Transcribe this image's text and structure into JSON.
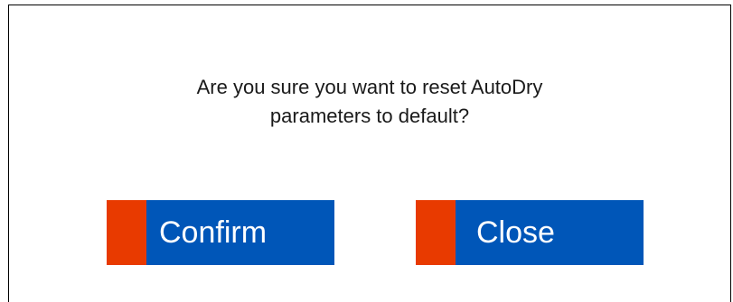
{
  "dialog": {
    "message_line1": "Are you sure you want to reset AutoDry",
    "message_line2": "parameters to default?"
  },
  "buttons": {
    "confirm_label": "Confirm",
    "close_label": "Close"
  },
  "colors": {
    "button_face": "#0056b8",
    "button_accent": "#e83a00",
    "border": "#000000",
    "text": "#1a1a1a"
  }
}
